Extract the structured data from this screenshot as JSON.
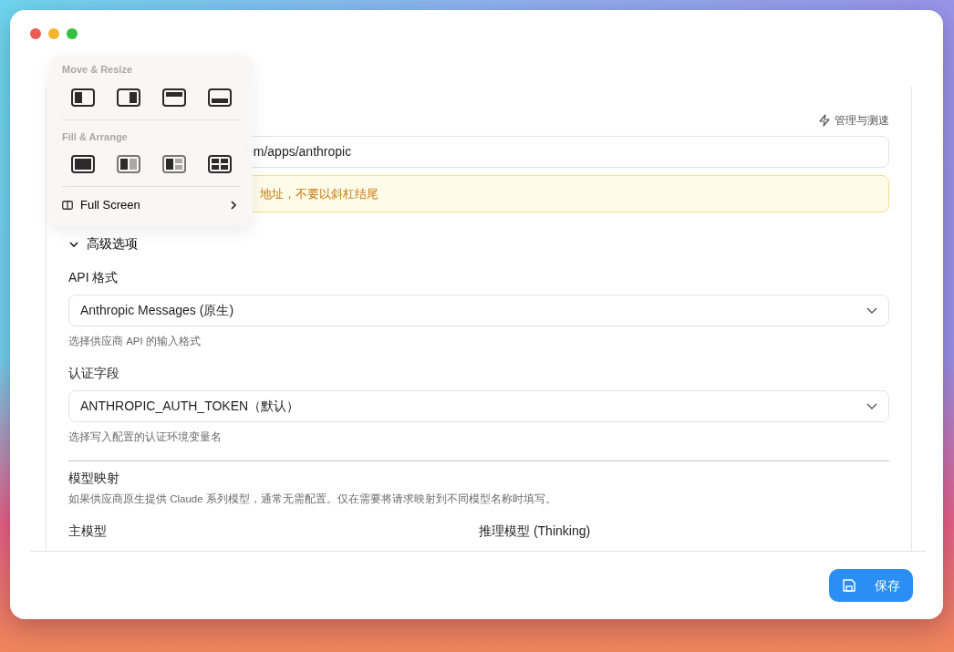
{
  "window_menu": {
    "sections": [
      {
        "heading": "Move & Resize",
        "items": [
          {
            "kind": "left-half"
          },
          {
            "kind": "right-half"
          },
          {
            "kind": "top-half"
          },
          {
            "kind": "bottom-half"
          }
        ]
      },
      {
        "heading": "Fill & Arrange",
        "items": [
          {
            "kind": "fill"
          },
          {
            "kind": "split-two"
          },
          {
            "kind": "split-three"
          },
          {
            "kind": "quarters"
          }
        ]
      }
    ],
    "full_screen": {
      "label": "Full Screen"
    }
  },
  "provider_form": {
    "test_link": "管理与测速",
    "url_field": {
      "value": "om/apps/anthropic"
    },
    "warning": "地址，不要以斜杠结尾",
    "advanced": {
      "label": "高级选项",
      "expanded": true,
      "fields": [
        {
          "label": "API 格式",
          "value": "Anthropic Messages (原生)",
          "hint": "选择供应商 API 的输入格式"
        },
        {
          "label": "认证字段",
          "value": "ANTHROPIC_AUTH_TOKEN（默认）",
          "hint": "选择写入配置的认证环境变量名"
        }
      ]
    },
    "model_mapping": {
      "title": "模型映射",
      "description": "如果供应商原生提供 Claude 系列模型，通常无需配置。仅在需要将请求映射到不同模型名称时填写。",
      "columns": [
        "主模型",
        "推理模型 (Thinking)"
      ]
    }
  },
  "save_button": {
    "label": "保存"
  }
}
